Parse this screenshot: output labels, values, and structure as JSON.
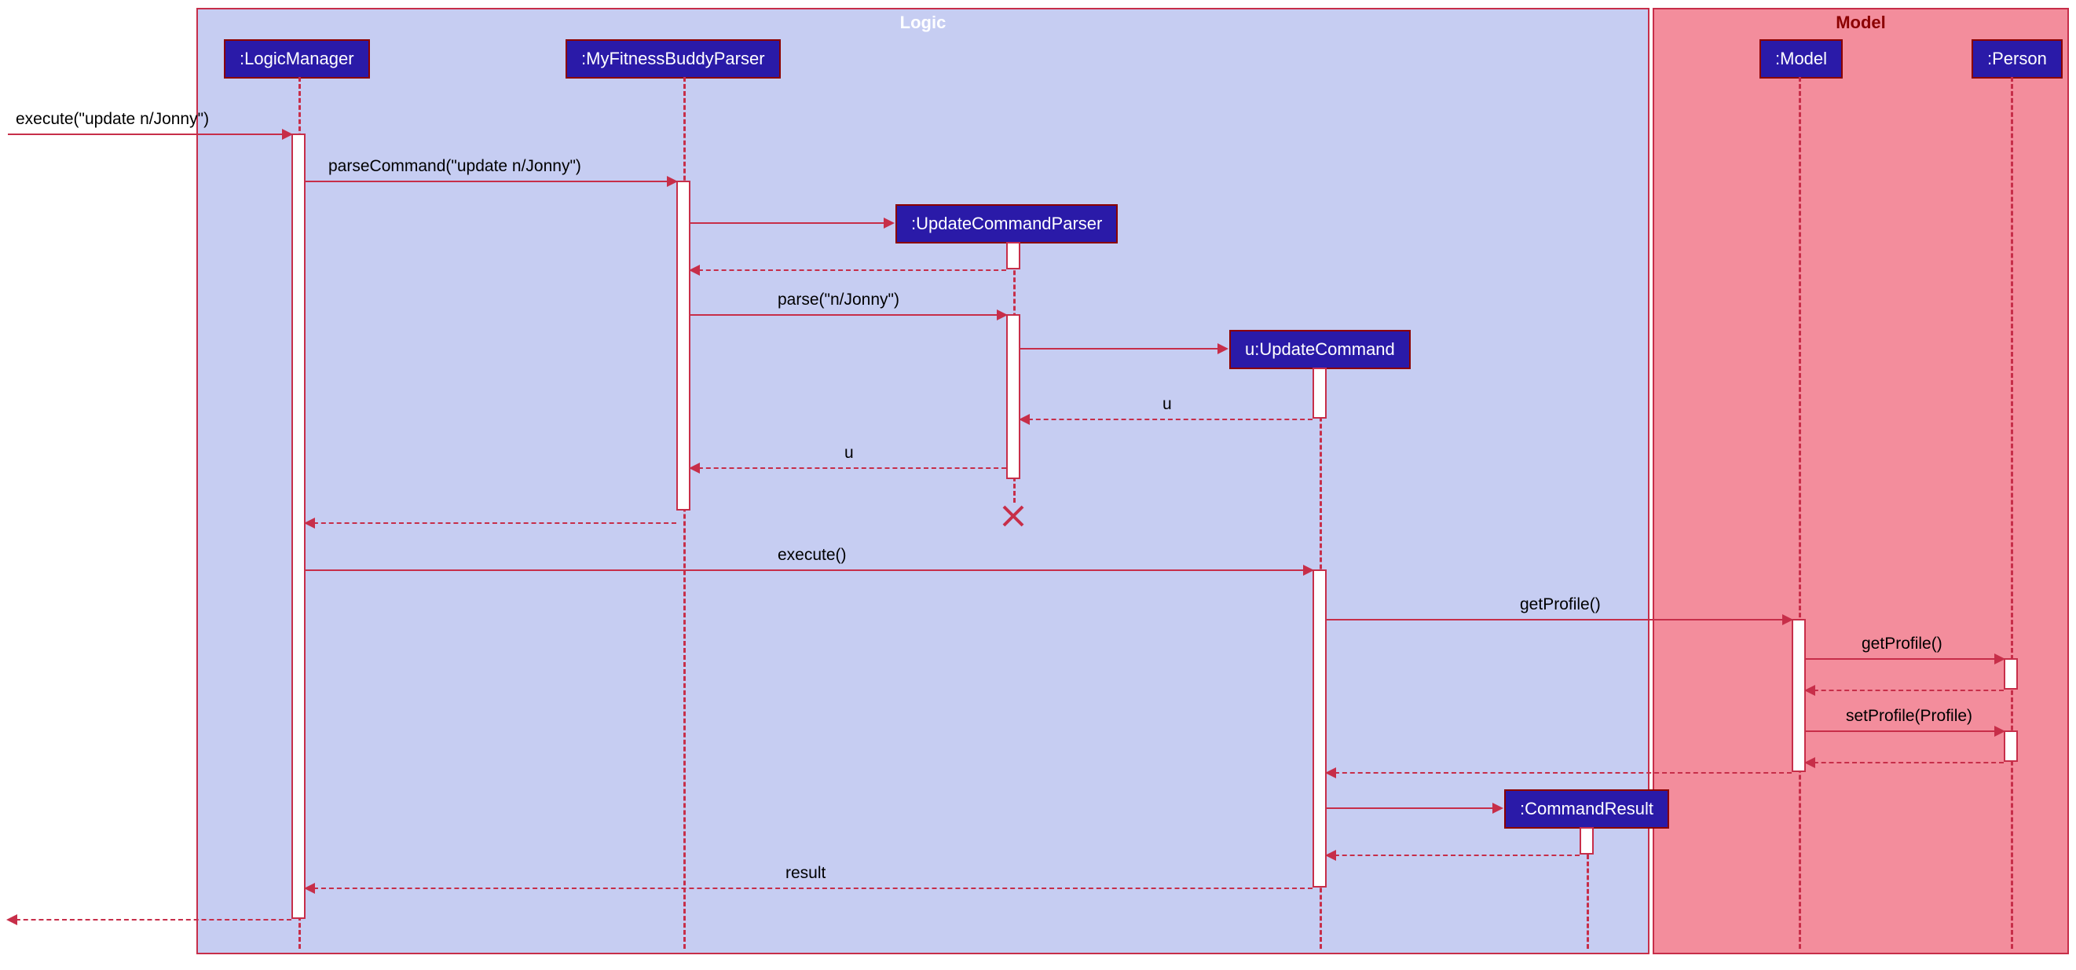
{
  "containers": {
    "logic": {
      "title": "Logic"
    },
    "model": {
      "title": "Model"
    }
  },
  "participants": {
    "logicManager": ":LogicManager",
    "parser": ":MyFitnessBuddyParser",
    "updateCmdParser": ":UpdateCommandParser",
    "updateCmd": "u:UpdateCommand",
    "commandResult": ":CommandResult",
    "model": ":Model",
    "person": ":Person"
  },
  "messages": {
    "m1": "execute(\"update n/Jonny\")",
    "m2": "parseCommand(\"update n/Jonny\")",
    "m3": "parse(\"n/Jonny\")",
    "m4": "u",
    "m5": "u",
    "m6": "execute()",
    "m7": "getProfile()",
    "m8": "getProfile()",
    "m9": "setProfile(Profile)",
    "m10": "result"
  }
}
